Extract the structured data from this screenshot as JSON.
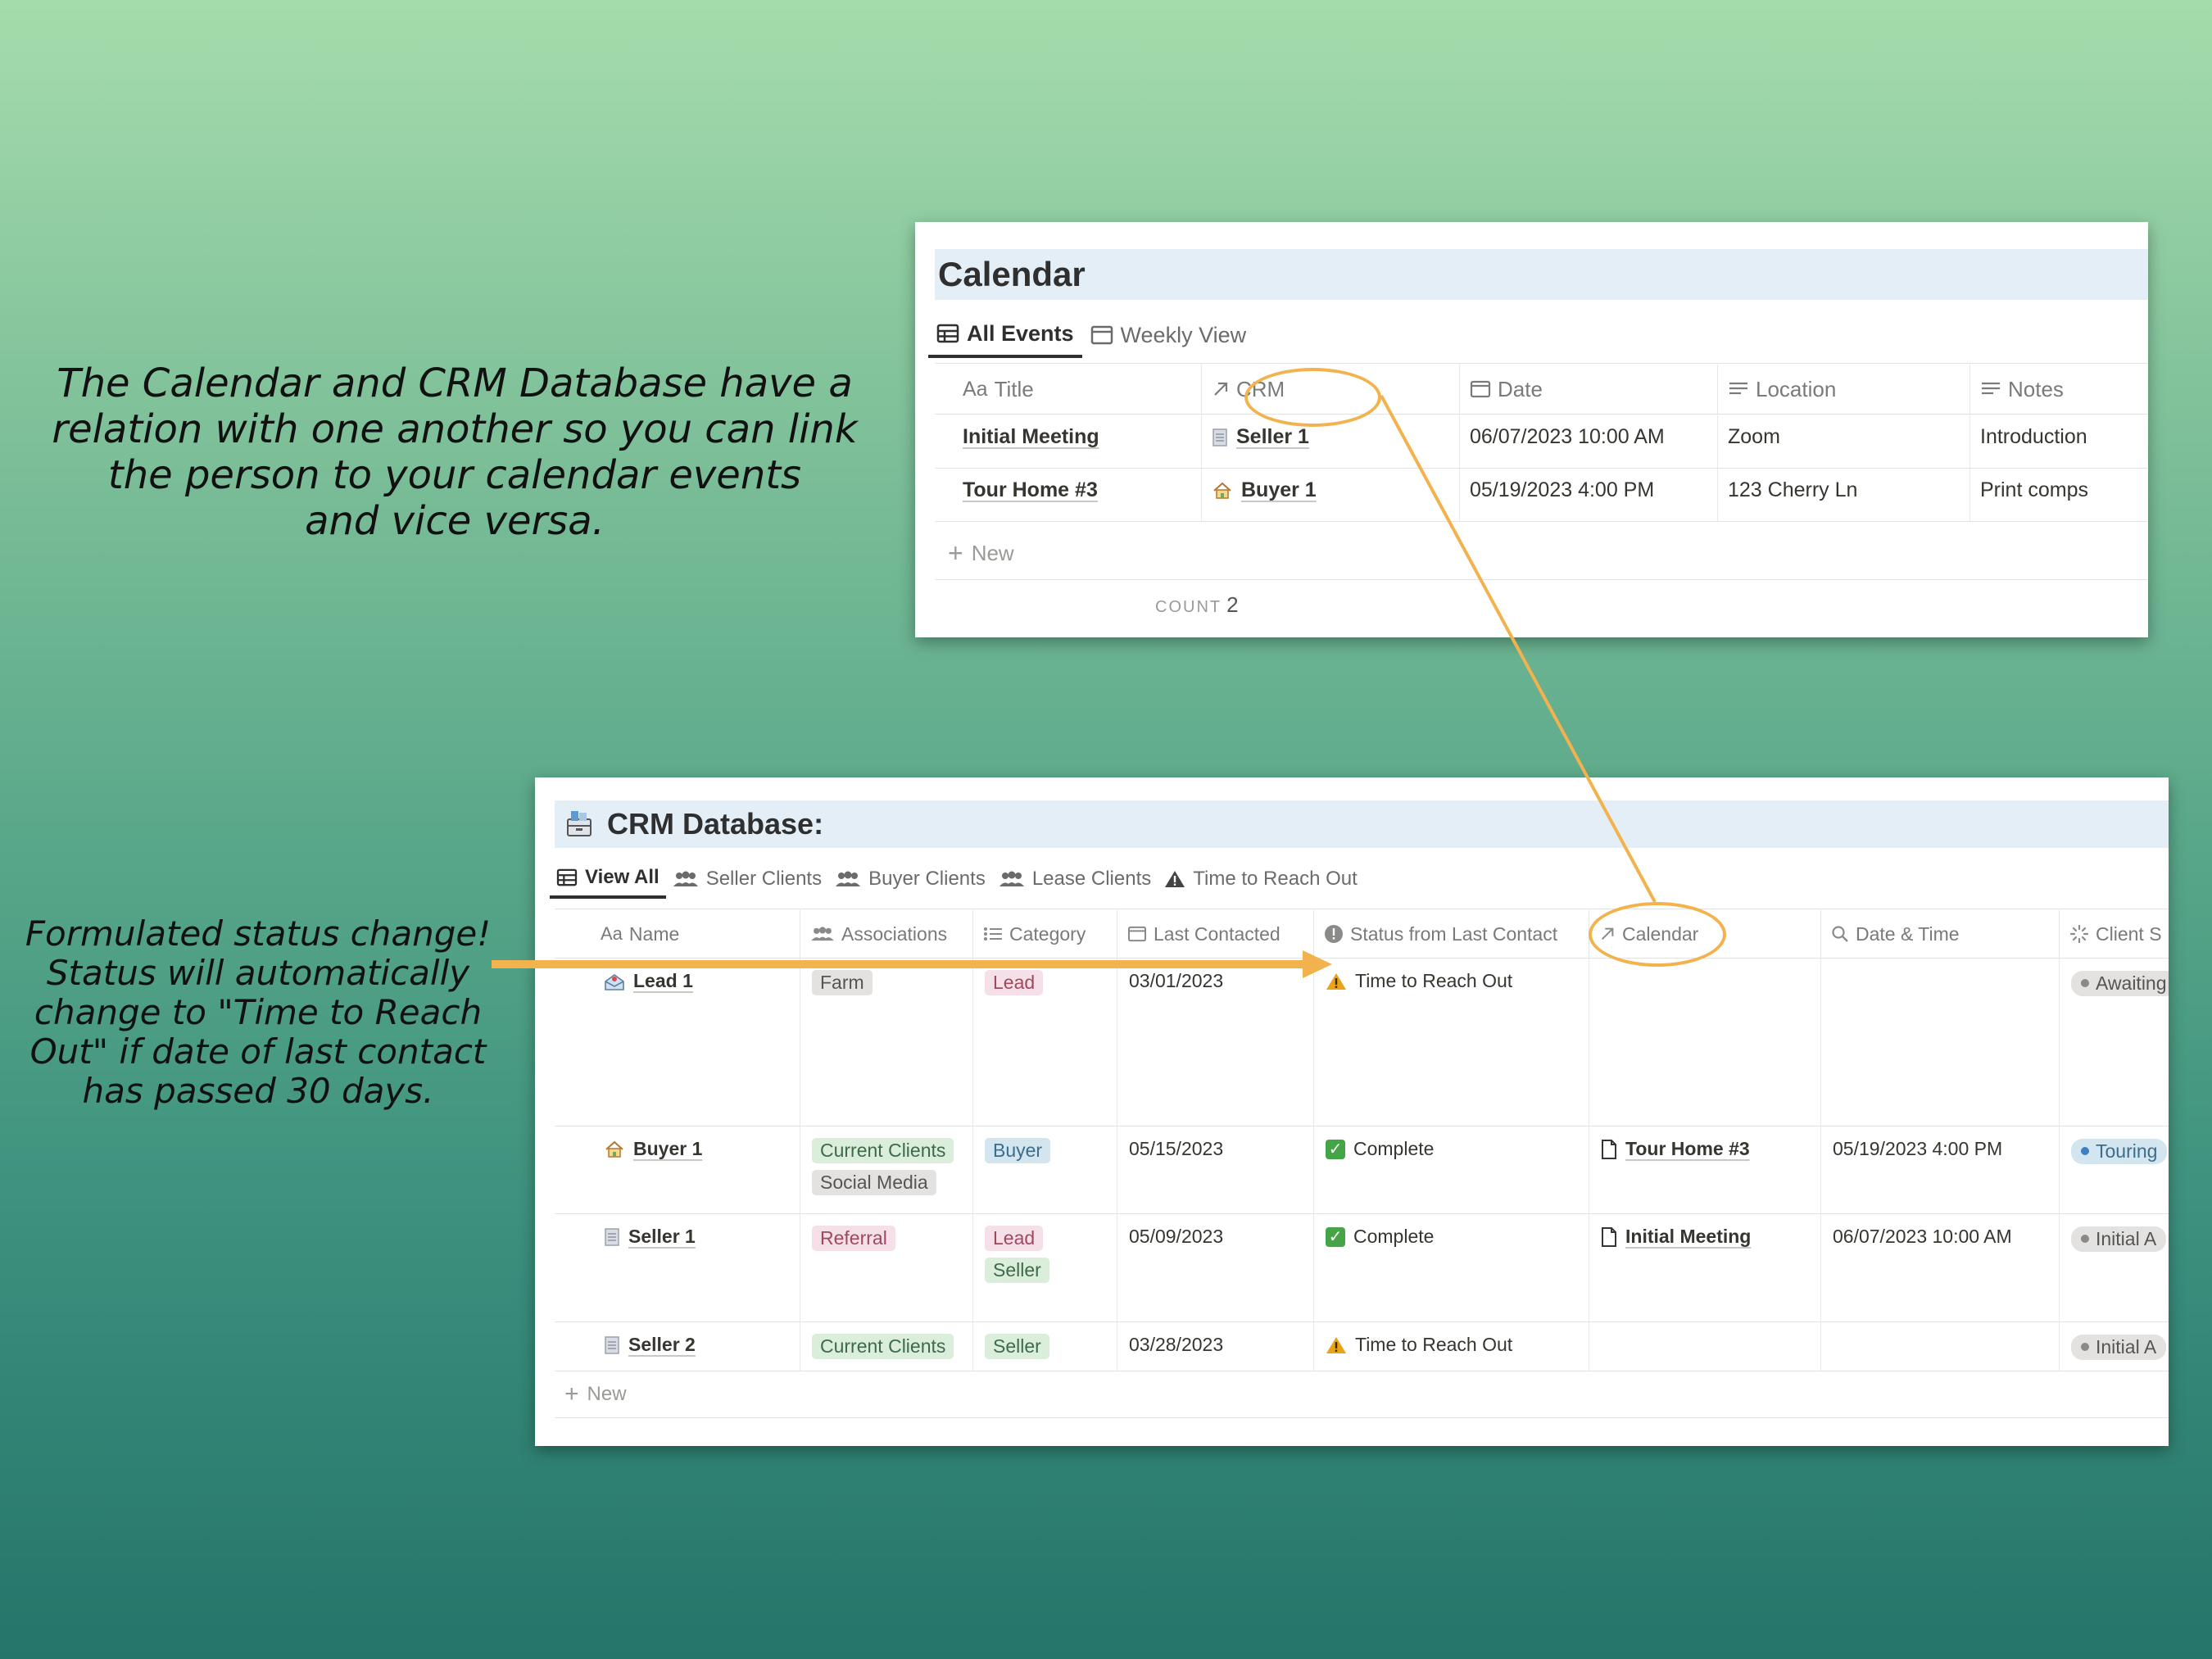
{
  "captions": {
    "relation": [
      "The Calendar and CRM Database have a",
      "relation with one another so you can link",
      "the person to your calendar events",
      "and vice versa."
    ],
    "status": [
      "Formulated status change!",
      "Status will automatically",
      "change to \"Time to Reach",
      "Out\" if date of last contact",
      "has passed 30 days."
    ]
  },
  "calendar": {
    "title": "Calendar",
    "tabs": [
      "All Events",
      "Weekly View"
    ],
    "columns": [
      "Title",
      "CRM",
      "Date",
      "Location",
      "Notes"
    ],
    "title_prefix": "Aa",
    "rows": [
      {
        "title": "Initial Meeting",
        "crm": "Seller 1",
        "date": "06/07/2023 10:00 AM",
        "location": "Zoom",
        "notes": "Introduction"
      },
      {
        "title": "Tour Home #3",
        "crm": "Buyer 1",
        "date": "05/19/2023 4:00 PM",
        "location": "123 Cherry Ln",
        "notes": "Print comps"
      }
    ],
    "new_label": "New",
    "count_label": "COUNT",
    "count_value": "2"
  },
  "crm": {
    "title": "CRM Database:",
    "tabs": [
      "View All",
      "Seller Clients",
      "Buyer Clients",
      "Lease Clients",
      "Time to Reach Out"
    ],
    "name_prefix": "Aa",
    "columns": [
      "Name",
      "Associations",
      "Category",
      "Last Contacted",
      "Status from Last Contact",
      "Calendar",
      "Date & Time",
      "Client S"
    ],
    "rows": [
      {
        "name": "Lead 1",
        "associations": [
          "Farm"
        ],
        "category": [
          "Lead"
        ],
        "last_contacted": "03/01/2023",
        "status": "Time to Reach Out",
        "calendar": "",
        "date_time": "",
        "client_status": "Awaiting"
      },
      {
        "name": "Buyer 1",
        "associations": [
          "Current Clients",
          "Social Media"
        ],
        "category": [
          "Buyer"
        ],
        "last_contacted": "05/15/2023",
        "status": "Complete",
        "calendar": "Tour Home #3",
        "date_time": "05/19/2023 4:00 PM",
        "client_status": "Touring"
      },
      {
        "name": "Seller 1",
        "associations": [
          "Referral"
        ],
        "category": [
          "Lead",
          "Seller"
        ],
        "last_contacted": "05/09/2023",
        "status": "Complete",
        "calendar": "Initial Meeting",
        "date_time": "06/07/2023 10:00 AM",
        "client_status": "Initial A"
      },
      {
        "name": "Seller 2",
        "associations": [
          "Current Clients"
        ],
        "category": [
          "Seller"
        ],
        "last_contacted": "03/28/2023",
        "status": "Time to Reach Out",
        "calendar": "",
        "date_time": "",
        "client_status": "Initial A"
      }
    ],
    "new_label": "New"
  },
  "colors": {
    "accent": "#f2b24d",
    "check": "#45a546",
    "warn": "#e8a317"
  }
}
